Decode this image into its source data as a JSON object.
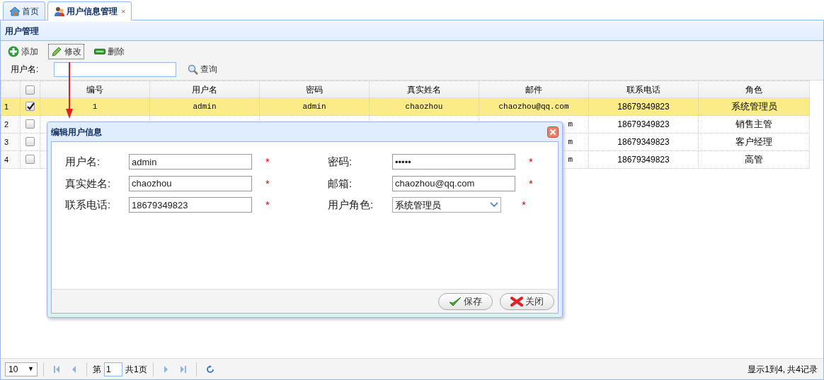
{
  "tabs": [
    {
      "label": "首页",
      "closable": false,
      "selected": false
    },
    {
      "label": "用户信息管理",
      "closable": true,
      "selected": true
    }
  ],
  "tab_close_mark": "×",
  "panel_title": "用户管理",
  "toolbar": [
    {
      "label": "添加",
      "kind": "add",
      "focused": false
    },
    {
      "label": "修改",
      "kind": "edit",
      "focused": true
    },
    {
      "label": "删除",
      "kind": "delete",
      "focused": false
    }
  ],
  "search": {
    "label": "用户名:",
    "button": "查询"
  },
  "table": {
    "all_checked": false,
    "columns": [
      "编号",
      "用户名",
      "密码",
      "真实姓名",
      "邮件",
      "联系电话",
      "角色"
    ],
    "rows": [
      {
        "number": "1",
        "checked": true,
        "selected": true,
        "cells": [
          "1",
          "admin",
          "admin",
          "chaozhou",
          "chaozhou@qq.com",
          "18679349823",
          "系统管理员"
        ]
      },
      {
        "number": "2",
        "checked": false,
        "selected": false,
        "cells": [
          null,
          null,
          null,
          null,
          "m",
          "18679349823",
          "销售主管"
        ]
      },
      {
        "number": "3",
        "checked": false,
        "selected": false,
        "cells": [
          null,
          null,
          null,
          null,
          "m",
          "18679349823",
          "客户经理"
        ]
      },
      {
        "number": "4",
        "checked": false,
        "selected": false,
        "cells": [
          null,
          null,
          null,
          null,
          "m",
          "18679349823",
          "高管"
        ]
      }
    ]
  },
  "dialog": {
    "title": "编辑用户信息",
    "fields": [
      {
        "label": "用户名:",
        "value": "admin",
        "kind": "text",
        "required": true
      },
      {
        "label": "密码:",
        "value": "•••••",
        "kind": "text",
        "required": true
      },
      {
        "label": "真实姓名:",
        "value": "chaozhou",
        "kind": "text",
        "required": true
      },
      {
        "label": "邮箱:",
        "value": "chaozhou@qq.com",
        "kind": "text",
        "required": true
      },
      {
        "label": "联系电话:",
        "value": "18679349823",
        "kind": "text",
        "required": true
      },
      {
        "label": "用户角色:",
        "value": "系统管理员",
        "kind": "select",
        "required": true
      }
    ],
    "required_mark": "*",
    "buttons": [
      {
        "label": "保存",
        "kind": "save"
      },
      {
        "label": "关闭",
        "kind": "close"
      }
    ]
  },
  "pager": {
    "page_size": "10",
    "page_size_caret": "▼",
    "page_prefix": "第",
    "page": "1",
    "page_suffix": "共1页",
    "summary": "显示1到4, 共4记录"
  }
}
